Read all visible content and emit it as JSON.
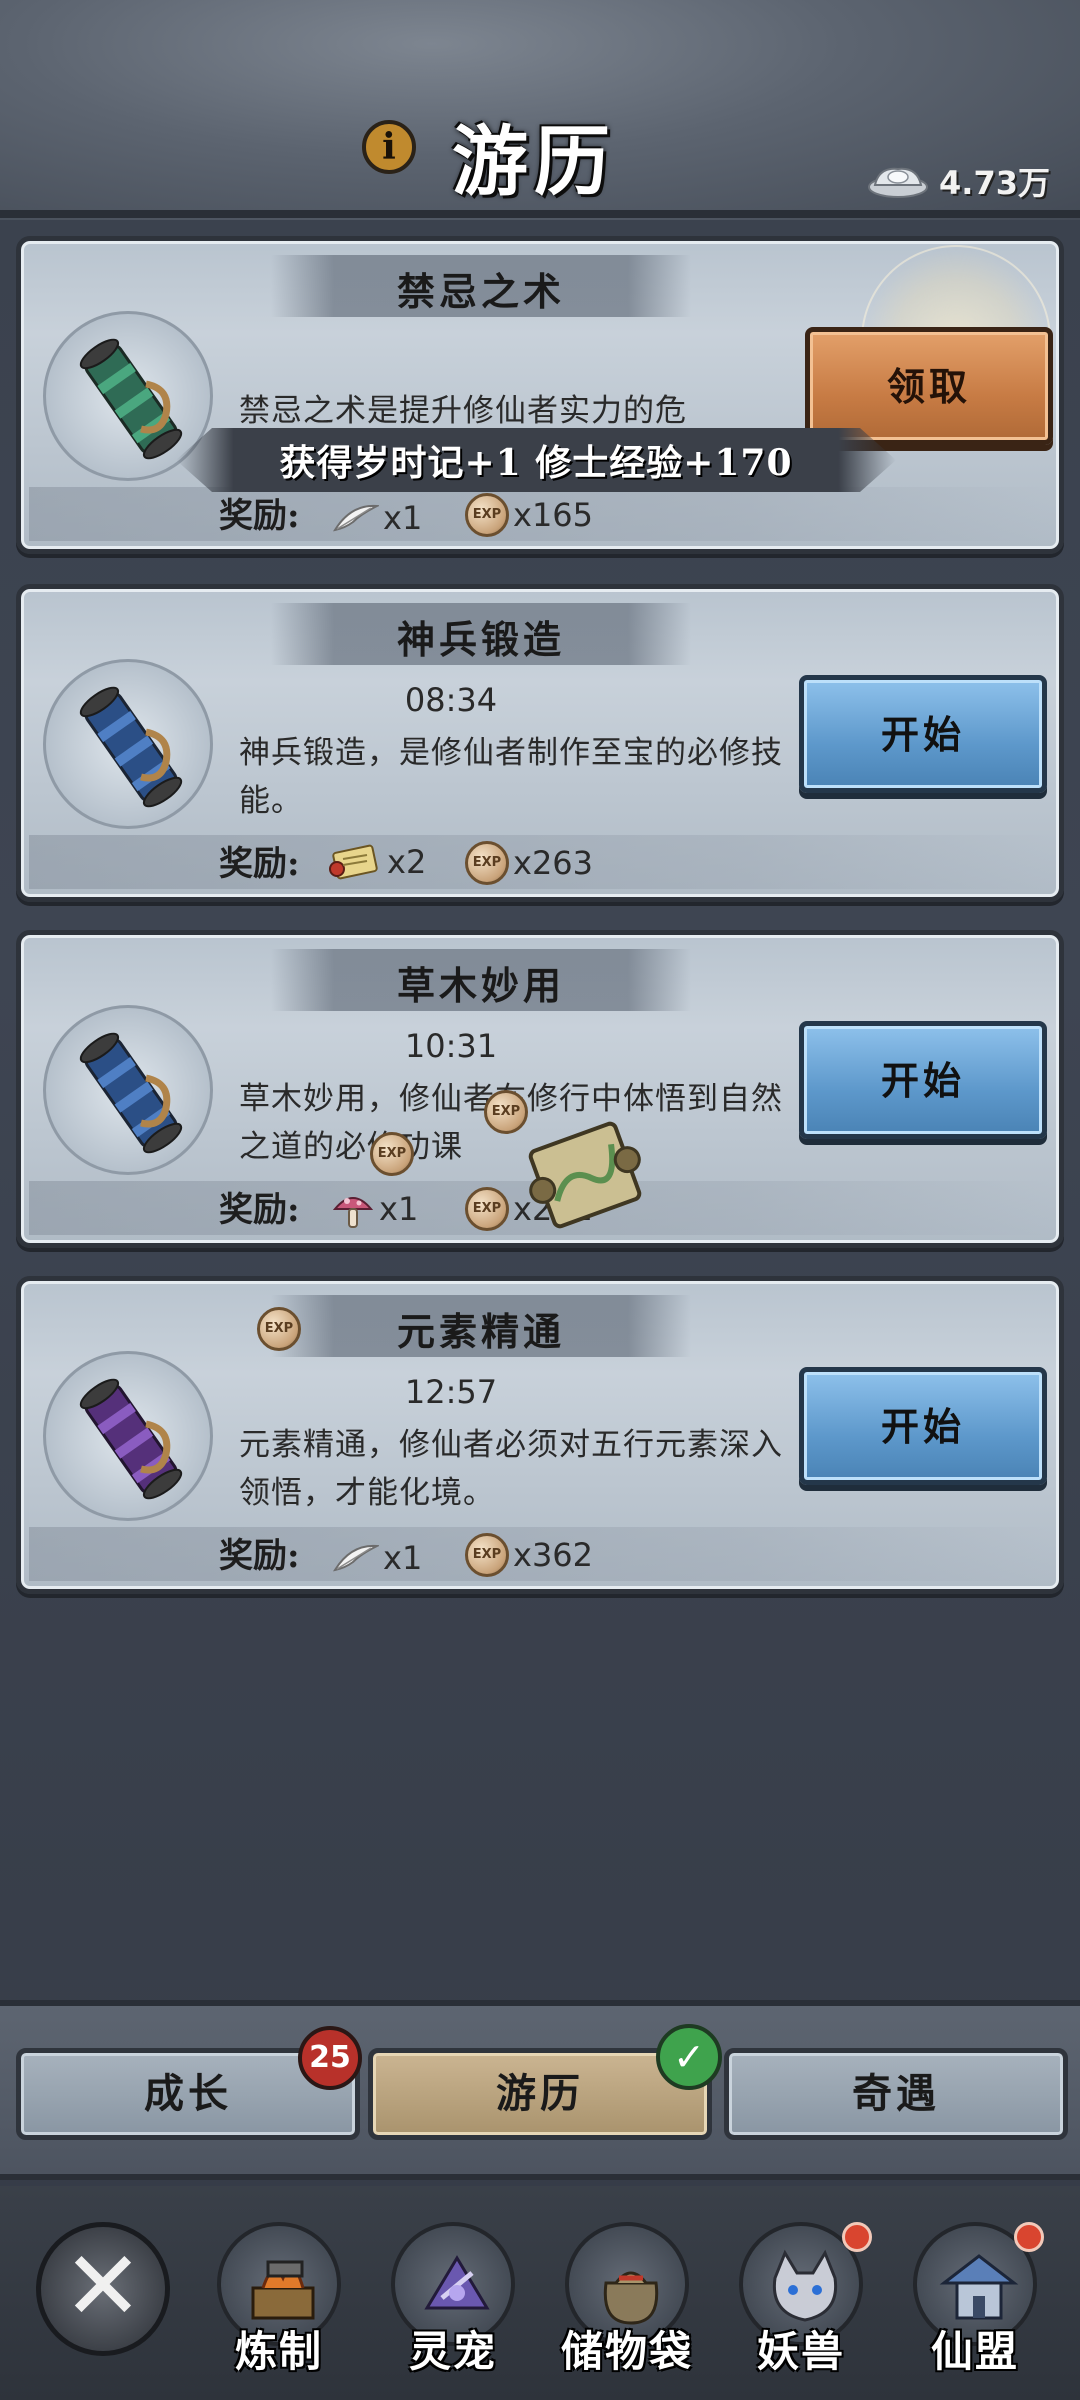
{
  "header": {
    "title": "游历",
    "info_icon": "i",
    "currency_icon": "silver-ingot-icon",
    "currency_value": "4.73万"
  },
  "quests": [
    {
      "title": "禁忌之术",
      "timer": "",
      "description": "禁忌之术是提升修仙者实力的危",
      "button": "领取",
      "button_state": "claim",
      "banner": "获得岁时记+1  修士经验+170",
      "reward_label": "奖励:",
      "rewards": [
        {
          "icon": "feather-icon",
          "count": "x1"
        },
        {
          "icon": "exp-icon",
          "count": "x165"
        }
      ]
    },
    {
      "title": "神兵锻造",
      "timer": "08:34",
      "description": "神兵锻造，是修仙者制作至宝的必修技能。",
      "button": "开始",
      "button_state": "start",
      "reward_label": "奖励:",
      "rewards": [
        {
          "icon": "scroll-item-icon",
          "count": "x2"
        },
        {
          "icon": "exp-icon",
          "count": "x263"
        }
      ]
    },
    {
      "title": "草木妙用",
      "timer": "10:31",
      "description": "草木妙用，修仙者在修行中体悟到自然之道的必修功课",
      "button": "开始",
      "button_state": "start",
      "reward_label": "奖励:",
      "rewards": [
        {
          "icon": "mushroom-icon",
          "count": "x1"
        },
        {
          "icon": "exp-icon",
          "count": "x262"
        }
      ]
    },
    {
      "title": "元素精通",
      "timer": "12:57",
      "description": "元素精通，修仙者必须对五行元素深入领悟，才能化境。",
      "button": "开始",
      "button_state": "start",
      "reward_label": "奖励:",
      "rewards": [
        {
          "icon": "feather-icon",
          "count": "x1"
        },
        {
          "icon": "exp-icon",
          "count": "x362"
        }
      ]
    }
  ],
  "exp_text": "EXP",
  "tabs": [
    {
      "label": "成长",
      "badge": "25"
    },
    {
      "label": "游历",
      "badge": "✓",
      "active": true
    },
    {
      "label": "奇遇"
    }
  ],
  "nav": {
    "close_label": "✕",
    "items": [
      {
        "label": "炼制",
        "icon": "forge-icon",
        "dot": false
      },
      {
        "label": "灵宠",
        "icon": "spirit-pet-icon",
        "dot": false
      },
      {
        "label": "储物袋",
        "icon": "storage-bag-icon",
        "dot": false
      },
      {
        "label": "妖兽",
        "icon": "demon-beast-icon",
        "dot": true
      },
      {
        "label": "仙盟",
        "icon": "immortal-alliance-icon",
        "dot": true
      }
    ]
  },
  "colors": {
    "button_blue": "#5d98cb",
    "button_orange": "#c77b44",
    "badge_red": "#b8312a",
    "badge_green": "#3fa34d"
  }
}
